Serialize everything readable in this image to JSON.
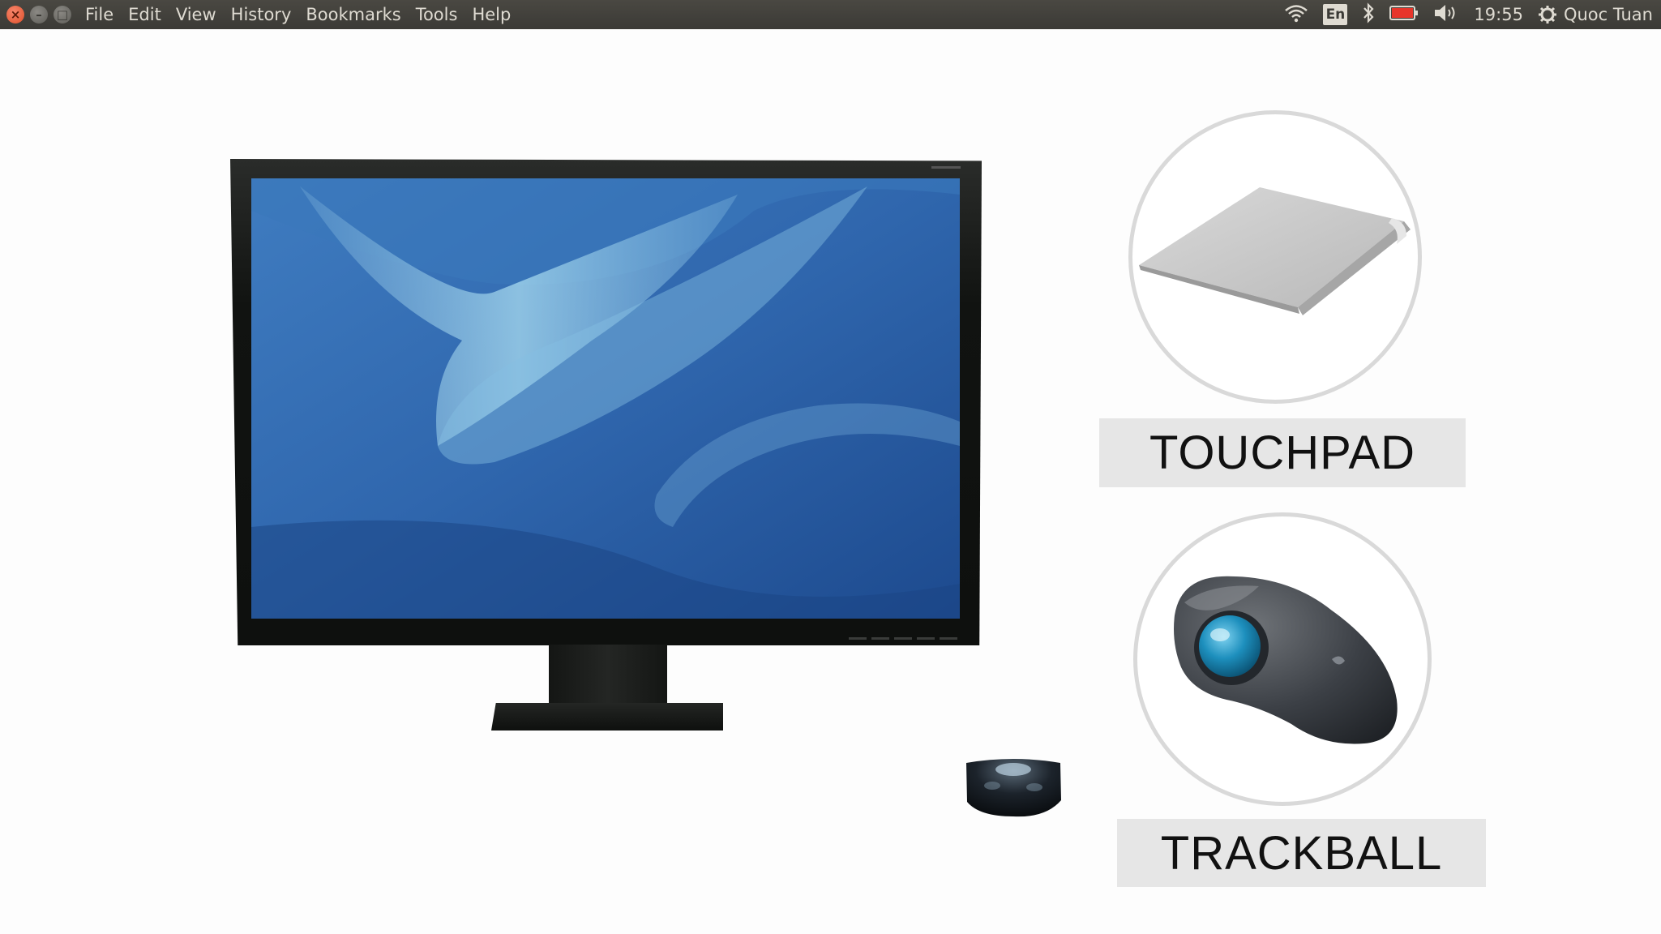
{
  "window_controls": {
    "close_icon": "close-icon",
    "minimize_icon": "minimize-icon",
    "maximize_icon": "maximize-icon"
  },
  "menu": {
    "items": [
      "File",
      "Edit",
      "View",
      "History",
      "Bookmarks",
      "Tools",
      "Help"
    ]
  },
  "tray": {
    "wifi_icon": "wifi-icon",
    "language": "En",
    "bluetooth_icon": "bluetooth-icon",
    "battery_icon": "battery-icon",
    "volume_icon": "volume-icon",
    "clock": "19:55",
    "user_name": "Quoc Tuan"
  },
  "slide": {
    "touchpad_label": "TOUCHPAD",
    "trackball_label": "TRACKBALL"
  },
  "colors": {
    "topbar": "#3b3a36",
    "close_button": "#e0502a",
    "battery_low": "#e8352a",
    "label_bg": "#e6e6e6",
    "screen_blue": "#2d5fa3"
  }
}
